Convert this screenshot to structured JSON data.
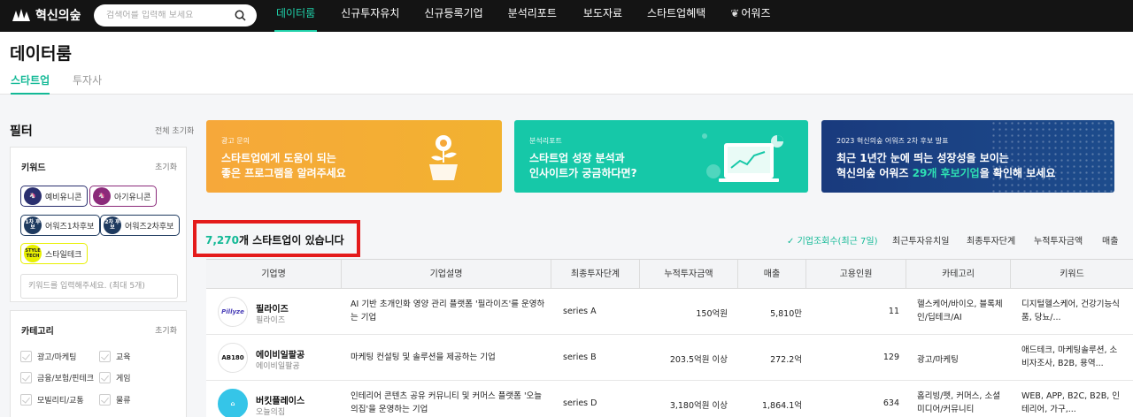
{
  "nav": {
    "logo_text": "혁신의숲",
    "search_placeholder": "검색어를 입력해 보세요",
    "items": [
      {
        "label": "데이터룸",
        "active": true
      },
      {
        "label": "신규투자유치"
      },
      {
        "label": "신규등록기업"
      },
      {
        "label": "분석리포트"
      },
      {
        "label": "보도자료"
      },
      {
        "label": "스타트업혜택"
      },
      {
        "label": "어워즈"
      }
    ]
  },
  "header": {
    "title": "데이터룸",
    "tabs": [
      {
        "label": "스타트업",
        "active": true
      },
      {
        "label": "투자사"
      }
    ]
  },
  "filter": {
    "title": "필터",
    "reset_all": "전체 초기화",
    "keyword": {
      "title": "키워드",
      "reset": "초기화",
      "chips": [
        {
          "label": "예비유니콘",
          "icon_text": "",
          "color": "#2a2f6e"
        },
        {
          "label": "아기유니콘",
          "icon_text": "",
          "color": "#8b2a7a"
        },
        {
          "label": "어워즈1차후보",
          "icon_text": "1차 후보",
          "color": "#1e3a5f"
        },
        {
          "label": "어워즈2차후보",
          "icon_text": "2차 후보",
          "color": "#1e3a5f"
        },
        {
          "label": "스타일테크",
          "icon_text": "STYLE TECH",
          "color": "#e8f000"
        }
      ],
      "input_placeholder": "키워드를 입력해주세요. (최대 5개)"
    },
    "category": {
      "title": "카테고리",
      "reset": "초기화",
      "options": [
        "광고/마케팅",
        "교육",
        "금융/보험/핀테크",
        "게임",
        "모빌리티/교통",
        "물류"
      ]
    }
  },
  "banners": [
    {
      "tag": "광고 문의",
      "line1": "스타트업에게 도움이 되는",
      "line2": "좋은 프로그램을 알려주세요",
      "color": "#f5aa38"
    },
    {
      "tag": "분석리포트",
      "line1": "스타트업 성장 분석과",
      "line2": "인사이트가 궁금하다면?",
      "color": "#16c8a8"
    },
    {
      "tag": "2023 혁신의숲 어워즈 2차 후보 발표",
      "line1": "최근 1년간 눈에 띄는 성장성을 보이는",
      "line2_pre": "혁신의숲 어워즈 ",
      "line2_hl": "29개 후보기업",
      "line2_post": "을 확인해 보세요",
      "color": "#1b3f80"
    }
  ],
  "results": {
    "count": "7,270",
    "suffix": "개 스타트업이 있습니다"
  },
  "sort_options": [
    {
      "label": "기업조회수(최근 7일)",
      "active": true
    },
    {
      "label": "최근투자유치일"
    },
    {
      "label": "최종투자단계"
    },
    {
      "label": "누적투자금액"
    },
    {
      "label": "매출"
    }
  ],
  "table": {
    "columns": [
      "기업명",
      "기업설명",
      "최종투자단계",
      "누적투자금액",
      "매출",
      "고용인원",
      "카테고리",
      "키워드"
    ],
    "rows": [
      {
        "logo_text": "Pillyze",
        "logo_color": "#4a3fb8",
        "name": "필라이즈",
        "sub": "필라이즈",
        "desc": "AI 기반 초개인화 영양 관리 플랫폼 '필라이즈'를 운영하는 기업",
        "stage": "series A",
        "invest": "150억원",
        "revenue": "5,810만",
        "employees": "11",
        "category": "헬스케어/바이오, 블록체인/딥테크/AI",
        "keywords": "디지털헬스케어, 건강기능식품, 당뇨/..."
      },
      {
        "logo_text": "AB180",
        "logo_color": "#111111",
        "name": "에이비일팔공",
        "sub": "에이비일팔공",
        "desc": "마케팅 컨설팅 및 솔루션을 제공하는 기업",
        "stage": "series B",
        "invest": "203.5억원 이상",
        "revenue": "272.2억",
        "employees": "129",
        "category": "광고/마케팅",
        "keywords": "애드테크, 마케팅솔루션, 소비자조사, B2B, 용역..."
      },
      {
        "logo_text": "",
        "logo_color": "#35c5e8",
        "name": "버킷플레이스",
        "sub": "오늘의집",
        "desc": "인테리어 콘텐츠 공유 커뮤니티 및 커머스 플랫폼 '오늘의집'을 운영하는 기업",
        "stage": "series D",
        "invest": "3,180억원 이상",
        "revenue": "1,864.1억",
        "employees": "634",
        "category": "홈리빙/펫, 커머스, 소셜미디어/커뮤니티",
        "keywords": "WEB, APP, B2C, B2B, 인테리어, 가구,..."
      }
    ]
  }
}
